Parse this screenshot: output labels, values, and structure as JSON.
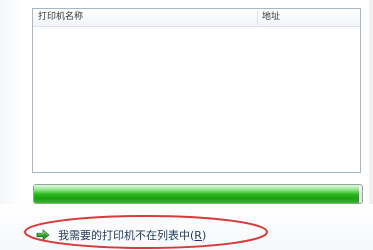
{
  "list": {
    "columns": [
      {
        "label": "打印机名称"
      },
      {
        "label": "地址"
      }
    ],
    "rows": []
  },
  "progress": {
    "fraction": 0.99,
    "color": "#27b519"
  },
  "link": {
    "text_prefix": "我需要的打印机不在列表中(",
    "accel_key": "R",
    "text_suffix": ")",
    "icon": "green-arrow-icon"
  },
  "annotation": {
    "color": "#d63a3a"
  }
}
